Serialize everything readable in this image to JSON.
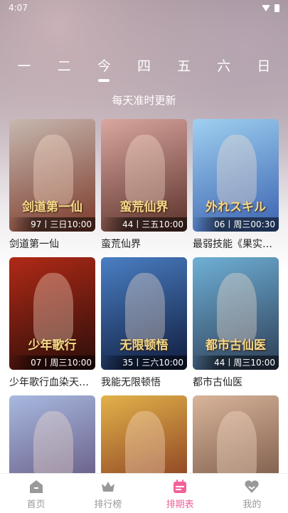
{
  "status_bar": {
    "time": "4:07"
  },
  "day_tabs": [
    {
      "label": "一",
      "active": false
    },
    {
      "label": "二",
      "active": false
    },
    {
      "label": "今",
      "active": true
    },
    {
      "label": "四",
      "active": false
    },
    {
      "label": "五",
      "active": false
    },
    {
      "label": "六",
      "active": false
    },
    {
      "label": "日",
      "active": false
    }
  ],
  "subtitle": "每天准时更新",
  "cards": [
    {
      "title": "剑道第一仙",
      "poster_text": "剑道第一仙",
      "badge": "97丨三日10:00",
      "colors": [
        "#c7b8b0",
        "#7b3a2a"
      ]
    },
    {
      "title": "蛮荒仙界",
      "poster_text": "蛮荒仙界",
      "badge": "44丨三五10:00",
      "colors": [
        "#d9a7a0",
        "#5a3028"
      ]
    },
    {
      "title": "最弱技能《果实…",
      "poster_text": "外れスキル",
      "badge": "06丨周三00:30",
      "colors": [
        "#9fd0f0",
        "#3a62b0"
      ]
    },
    {
      "title": "少年歌行血染天…",
      "poster_text": "少年歌行",
      "badge": "07丨周三10:00",
      "colors": [
        "#b02a16",
        "#2a0d0a"
      ]
    },
    {
      "title": "我能无限顿悟",
      "poster_text": "无限顿悟",
      "badge": "35丨三六10:00",
      "colors": [
        "#4a7fc4",
        "#0f1c3d"
      ]
    },
    {
      "title": "都市古仙医",
      "poster_text": "都市古仙医",
      "badge": "44丨周三10:00",
      "colors": [
        "#6fb0d6",
        "#2c3d55"
      ]
    },
    {
      "title": "",
      "poster_text": "",
      "badge": "",
      "colors": [
        "#a8b9e0",
        "#5a4a74"
      ]
    },
    {
      "title": "",
      "poster_text": "",
      "badge": "",
      "colors": [
        "#e2b24a",
        "#7a2a1a"
      ]
    },
    {
      "title": "",
      "poster_text": "",
      "badge": "",
      "colors": [
        "#d8b49a",
        "#6a4a3a"
      ]
    }
  ],
  "tabbar": {
    "items": [
      {
        "label": "首页",
        "icon": "home-icon",
        "active": false
      },
      {
        "label": "排行榜",
        "icon": "crown-icon",
        "active": false
      },
      {
        "label": "排期表",
        "icon": "calendar-icon",
        "active": true
      },
      {
        "label": "我的",
        "icon": "heart-icon",
        "active": false
      }
    ],
    "active_color": "#f0629a",
    "inactive_color": "#999999"
  }
}
